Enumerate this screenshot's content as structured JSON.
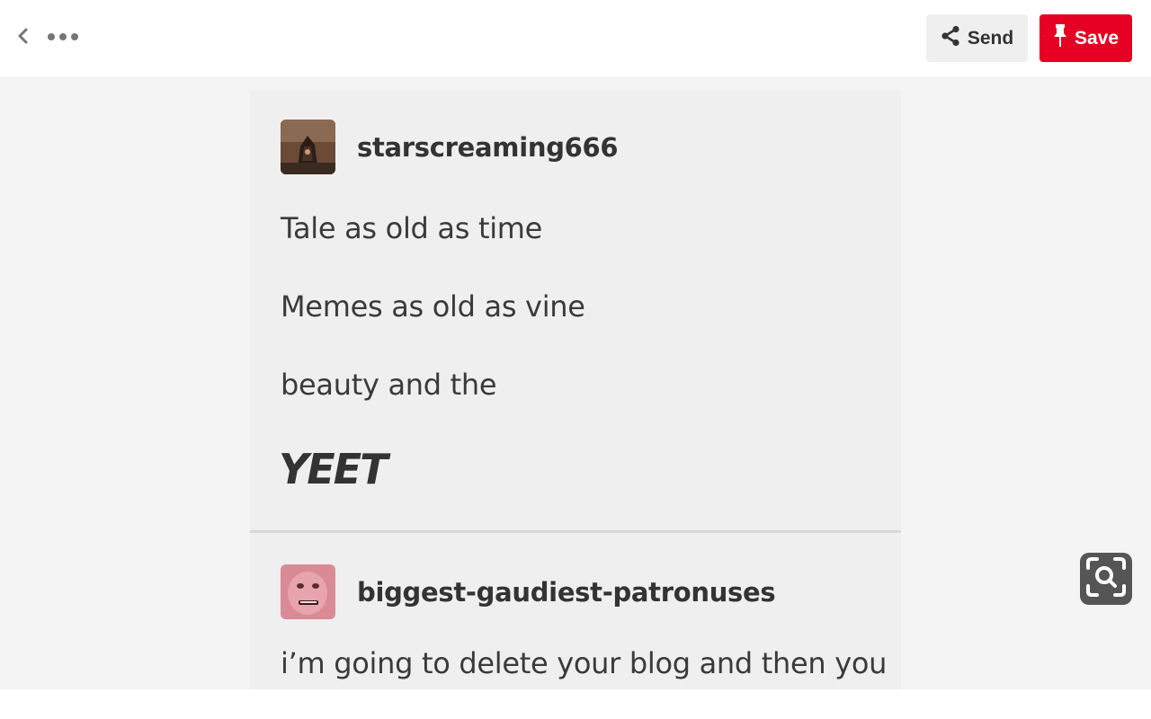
{
  "header": {
    "back_icon": "chevron-left-icon",
    "more_icon": "ellipsis-icon",
    "send_label": "Send",
    "send_icon": "share-icon",
    "save_label": "Save",
    "save_icon": "pin-icon",
    "save_color": "#e60023"
  },
  "pin": {
    "posts": [
      {
        "username": "starscreaming666",
        "lines": [
          "Tale as old as time",
          "Memes as old as vine",
          "beauty and the"
        ],
        "emphasis": "YEET"
      },
      {
        "username": "biggest-gaudiest-patronuses",
        "lines": [
          "i’m going to delete your blog and then you"
        ]
      }
    ]
  },
  "visual_search": {
    "icon": "visual-search-icon"
  }
}
